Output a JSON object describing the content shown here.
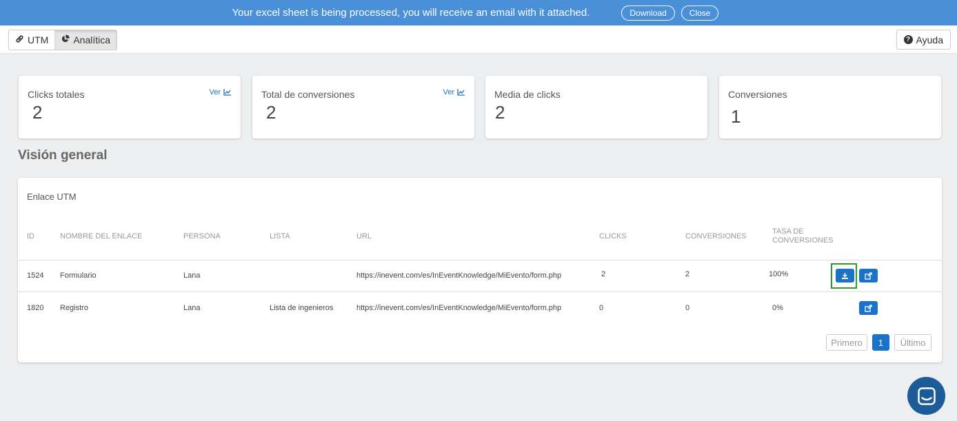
{
  "banner": {
    "message": "Your excel sheet is being processed, you will receive an email with it attached.",
    "download_label": "Download",
    "close_label": "Close"
  },
  "topbar": {
    "tabs": [
      {
        "label": "UTM",
        "icon": "link-icon"
      },
      {
        "label": "Analítica",
        "icon": "pie-chart-icon"
      }
    ],
    "help_label": "Ayuda"
  },
  "cards": [
    {
      "title": "Clicks totales",
      "value": "2",
      "link": "Ver"
    },
    {
      "title": "Total de conversiones",
      "value": "2",
      "link": "Ver"
    },
    {
      "title": "Media de clicks",
      "value": "2"
    },
    {
      "title": "Conversiones",
      "value": "1"
    }
  ],
  "section_title": "Visión general",
  "table": {
    "title": "Enlace UTM",
    "headers": [
      "ID",
      "NOMBRE DEL ENLACE",
      "PERSONA",
      "LISTA",
      "URL",
      "CLICKS",
      "CONVERSIONES",
      "TASA DE CONVERSIONES"
    ],
    "rows": [
      [
        "1524",
        "Formulario",
        "Lana",
        "",
        "https://inevent.com/es/InEventKnowledge/MiEvento/form.php",
        "2",
        "2",
        "100%"
      ],
      [
        "1820",
        "Registro",
        "Lana",
        "Lista de ingenieros",
        "https://inevent.com/es/InEventKnowledge/MiEvento/form.php",
        "0",
        "0",
        "0%"
      ]
    ]
  },
  "pagination": {
    "first": "Primero",
    "current": "1",
    "last": "Último"
  },
  "colors": {
    "banner": "#4a90d9",
    "primary_button": "#1a73c8",
    "highlight": "#2a9d2a",
    "chat": "#1b5c99"
  }
}
